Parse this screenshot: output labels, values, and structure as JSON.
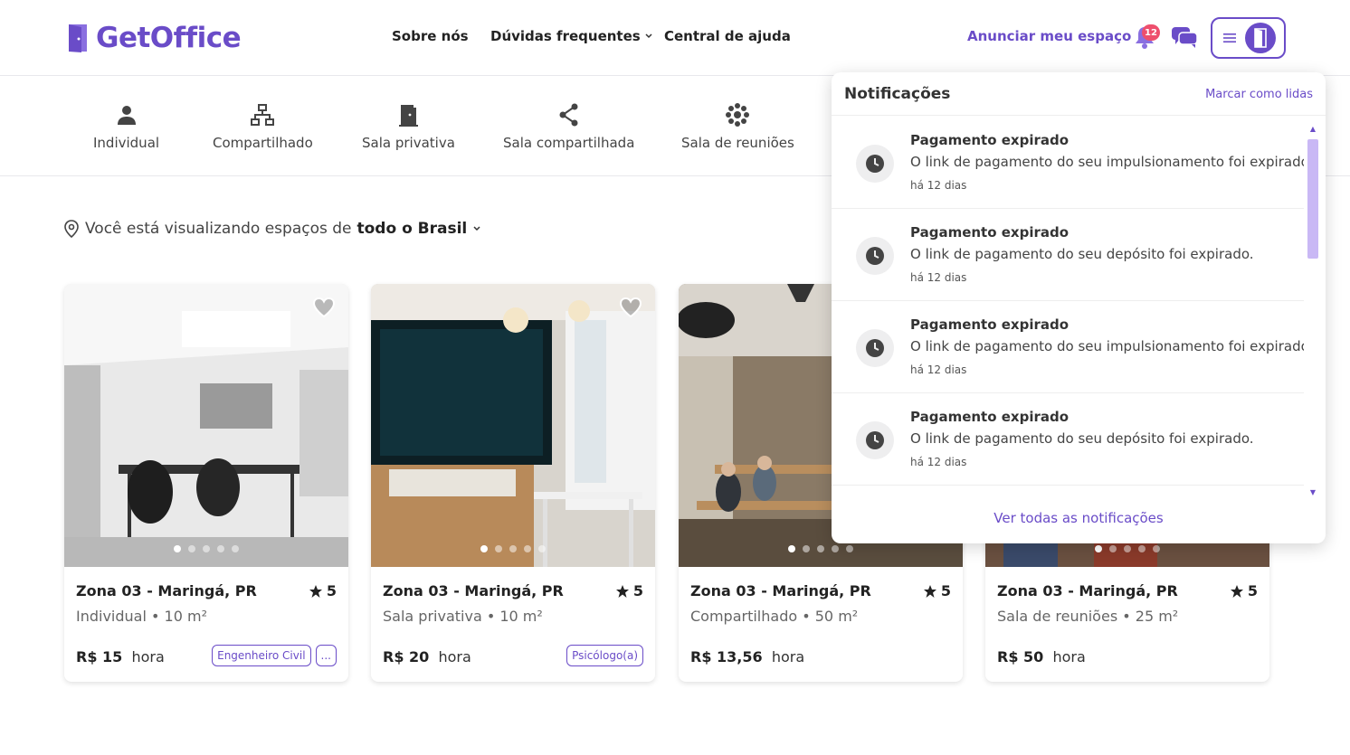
{
  "header": {
    "logo_text": "GetOffice",
    "nav": [
      {
        "label": "Sobre nós"
      },
      {
        "label": "Dúvidas frequentes"
      },
      {
        "label": "Central de ajuda"
      }
    ],
    "advertise_label": "Anunciar meu espaço",
    "notification_count": "12"
  },
  "categories": [
    {
      "label": "Individual",
      "icon": "person-icon"
    },
    {
      "label": "Compartilhado",
      "icon": "network-icon"
    },
    {
      "label": "Sala privativa",
      "icon": "door-icon"
    },
    {
      "label": "Sala compartilhada",
      "icon": "share-icon"
    },
    {
      "label": "Sala de reuniões",
      "icon": "hub-icon"
    }
  ],
  "location": {
    "prefix": "Você está visualizando espaços de",
    "value": "todo o Brasil"
  },
  "cards": [
    {
      "title": "Zona 03 - Maringá, PR",
      "rating": "5",
      "subtitle": "Individual • 10 m²",
      "price": "R$ 15",
      "unit": "hora",
      "tags": [
        "Engenheiro Civil",
        "..."
      ]
    },
    {
      "title": "Zona 03 - Maringá, PR",
      "rating": "5",
      "subtitle": "Sala privativa • 10 m²",
      "price": "R$ 20",
      "unit": "hora",
      "tags": [
        "Psicólogo(a)"
      ]
    },
    {
      "title": "Zona 03 - Maringá, PR",
      "rating": "5",
      "subtitle": "Compartilhado • 50 m²",
      "price": "R$ 13,56",
      "unit": "hora",
      "tags": []
    },
    {
      "title": "Zona 03 - Maringá, PR",
      "rating": "5",
      "subtitle": "Sala de reuniões • 25 m²",
      "price": "R$ 50",
      "unit": "hora",
      "tags": []
    }
  ],
  "notifications": {
    "title": "Notificações",
    "mark_read": "Marcar como lidas",
    "items": [
      {
        "title": "Pagamento expirado",
        "body": "O link de pagamento do seu impulsionamento foi expirado.",
        "time": "há 12 dias"
      },
      {
        "title": "Pagamento expirado",
        "body": "O link de pagamento do seu depósito foi expirado.",
        "time": "há 12 dias"
      },
      {
        "title": "Pagamento expirado",
        "body": "O link de pagamento do seu impulsionamento foi expirado.",
        "time": "há 12 dias"
      },
      {
        "title": "Pagamento expirado",
        "body": "O link de pagamento do seu depósito foi expirado.",
        "time": "há 12 dias"
      }
    ],
    "see_all": "Ver todas as notificações"
  },
  "colors": {
    "brand": "#6a4cc8",
    "badge": "#ee4f6d"
  }
}
